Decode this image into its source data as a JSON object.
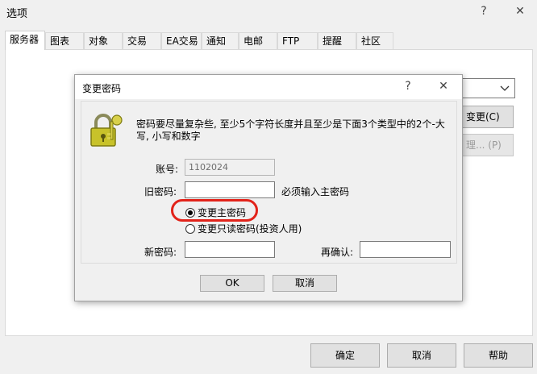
{
  "window": {
    "title": "选项",
    "help_glyph": "?",
    "close_glyph": "✕"
  },
  "tabs": [
    {
      "label": "服务器",
      "active": true
    },
    {
      "label": "图表"
    },
    {
      "label": "对象"
    },
    {
      "label": "交易"
    },
    {
      "label": "EA交易"
    },
    {
      "label": "通知"
    },
    {
      "label": "电邮"
    },
    {
      "label": "FTP"
    },
    {
      "label": "提醒"
    },
    {
      "label": "社区"
    }
  ],
  "behind": {
    "change_button": "变更(C)",
    "proxy_button": "理... (P)"
  },
  "dialog": {
    "title": "变更密码",
    "help_glyph": "?",
    "close_glyph": "✕",
    "description": "密码要尽量复杂些, 至少5个字符长度并且至少是下面3个类型中的2个-大写, 小写和数字",
    "account_label": "账号:",
    "account_value": "1102024",
    "old_password_label": "旧密码:",
    "old_password_value": "",
    "old_password_hint": "必须输入主密码",
    "radio_master": "变更主密码",
    "radio_readonly": "变更只读密码(投资人用)",
    "new_password_label": "新密码:",
    "new_password_value": "",
    "confirm_label": "再确认:",
    "confirm_value": "",
    "ok": "OK",
    "cancel": "取消"
  },
  "footer": {
    "ok": "确定",
    "cancel": "取消",
    "help": "帮助"
  },
  "colors": {
    "highlight": "#e2231a"
  },
  "icons": {
    "dialog": "keys-padlock-icon"
  }
}
